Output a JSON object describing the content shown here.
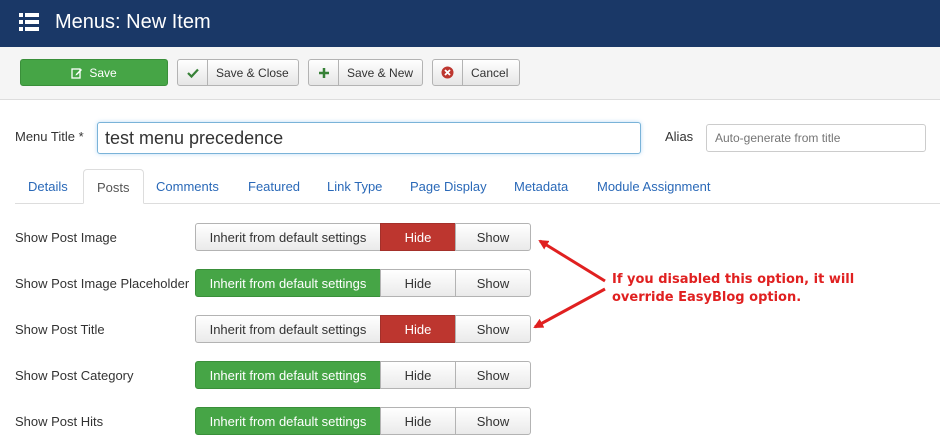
{
  "header": {
    "title": "Menus: New Item",
    "icon": "list-icon"
  },
  "toolbar": {
    "save": "Save",
    "save_close": "Save & Close",
    "save_new": "Save & New",
    "cancel": "Cancel"
  },
  "form": {
    "menu_title_label": "Menu Title *",
    "menu_title_value": "test menu precedence",
    "alias_label": "Alias",
    "alias_placeholder": "Auto-generate from title"
  },
  "tabs": [
    {
      "label": "Details",
      "active": false
    },
    {
      "label": "Posts",
      "active": true
    },
    {
      "label": "Comments",
      "active": false
    },
    {
      "label": "Featured",
      "active": false
    },
    {
      "label": "Link Type",
      "active": false
    },
    {
      "label": "Page Display",
      "active": false
    },
    {
      "label": "Metadata",
      "active": false
    },
    {
      "label": "Module Assignment",
      "active": false
    }
  ],
  "options": {
    "labels": {
      "inherit": "Inherit from default settings",
      "hide": "Hide",
      "show": "Show"
    },
    "rows": [
      {
        "label": "Show Post Image",
        "selected": "hide"
      },
      {
        "label": "Show Post Image Placeholder",
        "selected": "inherit"
      },
      {
        "label": "Show Post Title",
        "selected": "hide"
      },
      {
        "label": "Show Post Category",
        "selected": "inherit"
      },
      {
        "label": "Show Post Hits",
        "selected": "inherit"
      }
    ]
  },
  "annotation": {
    "line1": "If you disabled this option, it will",
    "line2": "override EasyBlog option.",
    "color": "#e02020"
  },
  "colors": {
    "header": "#1a3867",
    "save": "#46a546",
    "hide_active": "#bd362f",
    "inherit_active": "#46a546",
    "link": "#2a69b8"
  }
}
